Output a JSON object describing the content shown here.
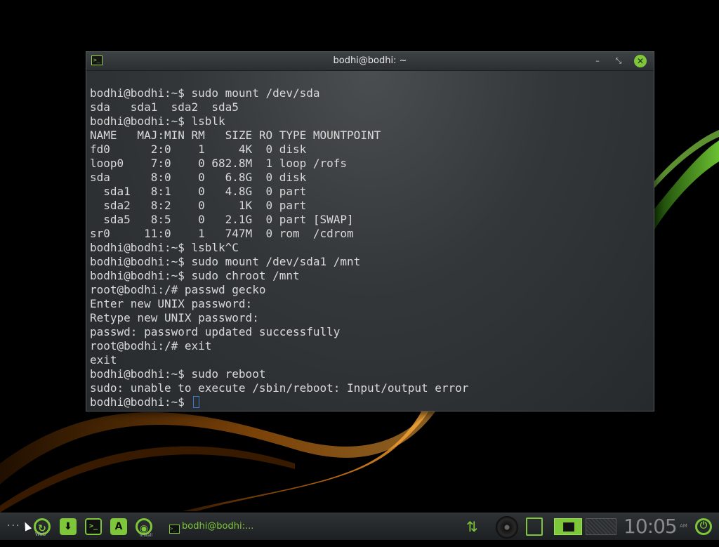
{
  "window": {
    "title": "bodhi@bodhi: ~",
    "minimize_symbol": "–",
    "maximize_symbol": "⤡",
    "close_symbol": "✕",
    "icon": "terminal-icon",
    "title_icon_glyph": ">_"
  },
  "terminal": {
    "lines": [
      "bodhi@bodhi:~$ sudo mount /dev/sda",
      "sda   sda1  sda2  sda5",
      "bodhi@bodhi:~$ lsblk",
      "NAME   MAJ:MIN RM   SIZE RO TYPE MOUNTPOINT",
      "fd0      2:0    1     4K  0 disk",
      "loop0    7:0    0 682.8M  1 loop /rofs",
      "sda      8:0    0   6.8G  0 disk",
      "  sda1   8:1    0   4.8G  0 part",
      "  sda2   8:2    0     1K  0 part",
      "  sda5   8:5    0   2.1G  0 part [SWAP]",
      "sr0     11:0    1   747M  0 rom  /cdrom",
      "bodhi@bodhi:~$ lsblk^C",
      "bodhi@bodhi:~$ sudo mount /dev/sda1 /mnt",
      "bodhi@bodhi:~$ sudo chroot /mnt",
      "root@bodhi:/# passwd gecko",
      "Enter new UNIX password:",
      "Retype new UNIX password:",
      "passwd: password updated successfully",
      "root@bodhi:/# exit",
      "exit",
      "bodhi@bodhi:~$ sudo reboot",
      "sudo: unable to execute /sbin/reboot: Input/output error"
    ],
    "prompt": "bodhi@bodhi:~$ "
  },
  "taskbar": {
    "menu_dots": "···",
    "launchers": [
      {
        "icon": "web-browser-icon",
        "label": "Web",
        "glyph": "↻"
      },
      {
        "icon": "download-icon",
        "glyph": "⬇"
      },
      {
        "icon": "terminal-icon",
        "glyph": ">_"
      },
      {
        "icon": "app-center-icon",
        "glyph": "A"
      },
      {
        "icon": "install-icon",
        "label": "Install",
        "glyph": "◉"
      }
    ],
    "task_button": {
      "label": "bodhi@bodhi:...",
      "icon": "terminal-icon",
      "glyph": ">_"
    },
    "tray": {
      "network_icon": "network-arrows-icon",
      "network_glyph": "⇅",
      "disc_icon": "disc-icon",
      "clipboard_icon": "clipboard-icon"
    },
    "pager": [
      "desktop-1",
      "desktop-2"
    ],
    "clock": {
      "time": "10:05",
      "ampm": "AM"
    },
    "power_icon": "power-icon",
    "power_glyph": "⏻"
  },
  "colors": {
    "accent": "#7ec63a",
    "terminal_bg": "#2c2f31",
    "terminal_text": "#d9d9d9"
  }
}
